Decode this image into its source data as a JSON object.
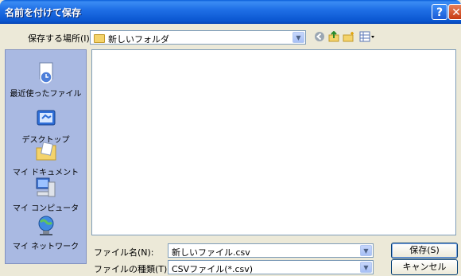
{
  "window": {
    "title": "名前を付けて保存",
    "help_glyph": "?",
    "close_glyph": "✕"
  },
  "lookin": {
    "label": "保存する場所(I):",
    "value": "新しいフォルダ"
  },
  "toolbar": {
    "back_icon": "back-arrow-icon",
    "up_icon": "up-folder-icon",
    "new_folder_icon": "new-folder-icon",
    "view_icon": "view-menu-icon"
  },
  "places": [
    {
      "label": "最近使ったファイル",
      "icon": "recent-documents-icon"
    },
    {
      "label": "デスクトップ",
      "icon": "desktop-icon"
    },
    {
      "label": "マイ ドキュメント",
      "icon": "my-documents-icon"
    },
    {
      "label": "マイ コンピュータ",
      "icon": "my-computer-icon"
    },
    {
      "label": "マイ ネットワーク",
      "icon": "my-network-icon"
    }
  ],
  "filename": {
    "label": "ファイル名(N):",
    "value": "新しいファイル.csv"
  },
  "filetype": {
    "label": "ファイルの種類(T):",
    "value": "CSVファイル(*.csv)"
  },
  "buttons": {
    "save": "保存(S)",
    "cancel": "キャンセル"
  },
  "colors": {
    "titlebar": "#0a56d0",
    "dialog_bg": "#ece9d8",
    "places_bg": "#a9b9e2",
    "border": "#7f9db9"
  }
}
